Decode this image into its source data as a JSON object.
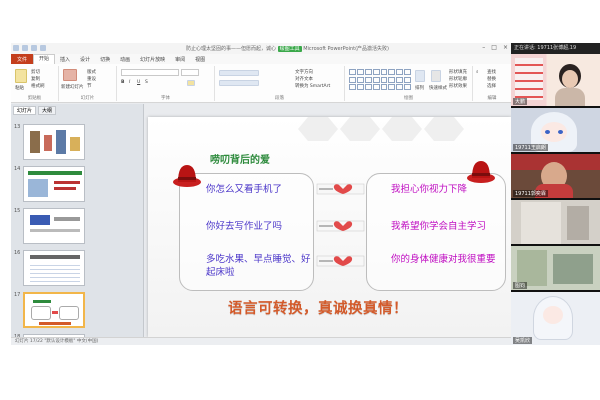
{
  "app": {
    "title": "防止心理太坚固的事——但愿而起，诚心",
    "title_highlight": "绘图工具",
    "title_suffix": "Microsoft PowerPoint(产品激活失败)"
  },
  "ribbon": {
    "file_tab": "文件",
    "tabs": [
      "开始",
      "插入",
      "设计",
      "切换",
      "动画",
      "幻灯片放映",
      "审阅",
      "视图"
    ],
    "active_tab": "开始",
    "clipboard": {
      "paste": "粘贴",
      "cut": "剪切",
      "copy": "复制",
      "format_painter": "格式刷",
      "group": "剪贴板"
    },
    "slides": {
      "new_slide": "新建幻灯片",
      "layout": "版式",
      "reset": "重设",
      "section": "节",
      "group": "幻灯片"
    },
    "font": {
      "group": "字体"
    },
    "paragraph": {
      "text_direction": "文字方向",
      "align_text": "对齐文本",
      "smartart": "转换为 SmartArt",
      "group": "段落"
    },
    "drawing": {
      "arrange": "排列",
      "quick_styles": "快速样式",
      "shape_fill": "形状填充",
      "shape_outline": "形状轮廓",
      "shape_effects": "形状效果",
      "group": "绘图"
    },
    "editing": {
      "find": "查找",
      "replace": "替换",
      "select": "选择",
      "group": "编辑"
    }
  },
  "thumbs": {
    "tabs": [
      "幻灯片",
      "大纲"
    ],
    "numbers": [
      "13",
      "14",
      "15",
      "16",
      "17",
      "18"
    ]
  },
  "slide": {
    "title": "唠叨背后的爱",
    "left_phrases": [
      "你怎么又看手机了",
      "你好去写作业了吗",
      "多吃水果、早点睡觉、好起床啦"
    ],
    "right_phrases": [
      "我担心你视力下降",
      "我希望你学会自主学习",
      "你的身体健康对我很重要"
    ],
    "slogan": "语言可转换，真诚换真情！"
  },
  "status": {
    "text": "幻灯片 17/22   \"默认设计模板\"   中文(中国)"
  },
  "video": {
    "header": "正在讲话: 19711张博超,19",
    "participants": [
      "大鹏",
      "19711王启朗",
      "19711郭奕霖",
      "",
      "图钧",
      "吴凯欣"
    ]
  },
  "colors": {
    "title_green": "#2e8b3d",
    "left_text": "#4a35c9",
    "right_text": "#c00ec2",
    "slogan": "#d35a2a",
    "file_tab": "#c43e1c"
  }
}
